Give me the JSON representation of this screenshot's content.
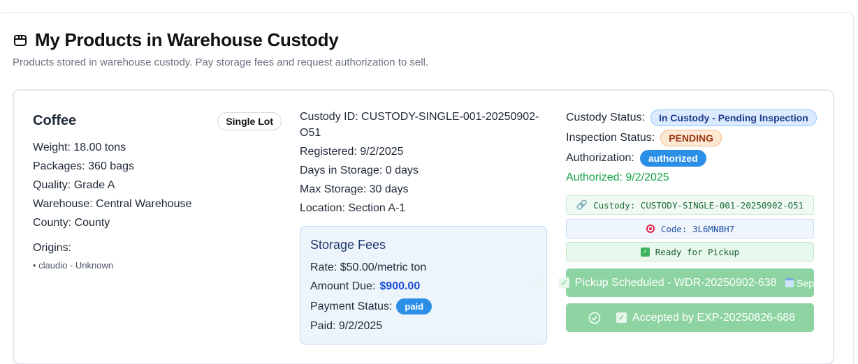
{
  "header": {
    "title": "My Products in Warehouse Custody",
    "subtitle": "Products stored in warehouse custody. Pay storage fees and request authorization to sell."
  },
  "product": {
    "name": "Coffee",
    "lot_type": "Single Lot",
    "weight": "Weight: 18.00 tons",
    "packages": "Packages: 360 bags",
    "quality": "Quality: Grade A",
    "warehouse": "Warehouse: Central Warehouse",
    "county": "County: County",
    "origins_label": "Origins:",
    "origins": [
      "• claudio - Unknown"
    ]
  },
  "custody": {
    "custody_id": "Custody ID: CUSTODY-SINGLE-001-20250902-O51",
    "registered": "Registered: 9/2/2025",
    "days_in_storage": "Days in Storage: 0 days",
    "max_storage": "Max Storage: 30 days",
    "location": "Location: Section A-1"
  },
  "storage_fees": {
    "title": "Storage Fees",
    "rate": "Rate: $50.00/metric ton",
    "amount_label": "Amount Due:",
    "amount_value": "$900.00",
    "payment_status_label": "Payment Status:",
    "payment_status": "paid",
    "paid_date": "Paid: 9/2/2025"
  },
  "status": {
    "custody_status_label": "Custody Status:",
    "custody_status": "In Custody - Pending Inspection",
    "inspection_status_label": "Inspection Status:",
    "inspection_status": "PENDING",
    "authorization_label": "Authorization:",
    "authorization": "authorized",
    "authorized_date": "Authorized: 9/2/2025"
  },
  "info_boxes": {
    "custody": "Custody: CUSTODY-SINGLE-001-20250902-O51",
    "code": "Code: 3L6MNBH7",
    "ready": "Ready for Pickup"
  },
  "actions": {
    "pickup": "Pickup Scheduled - WDR-20250902-638",
    "pickup_date": "Sep",
    "accepted": "Accepted by EXP-20250826-688"
  },
  "colors": {
    "accent_blue": "#2b8fe8",
    "success_green": "#16a34a",
    "action_green": "#8dd4a2"
  }
}
